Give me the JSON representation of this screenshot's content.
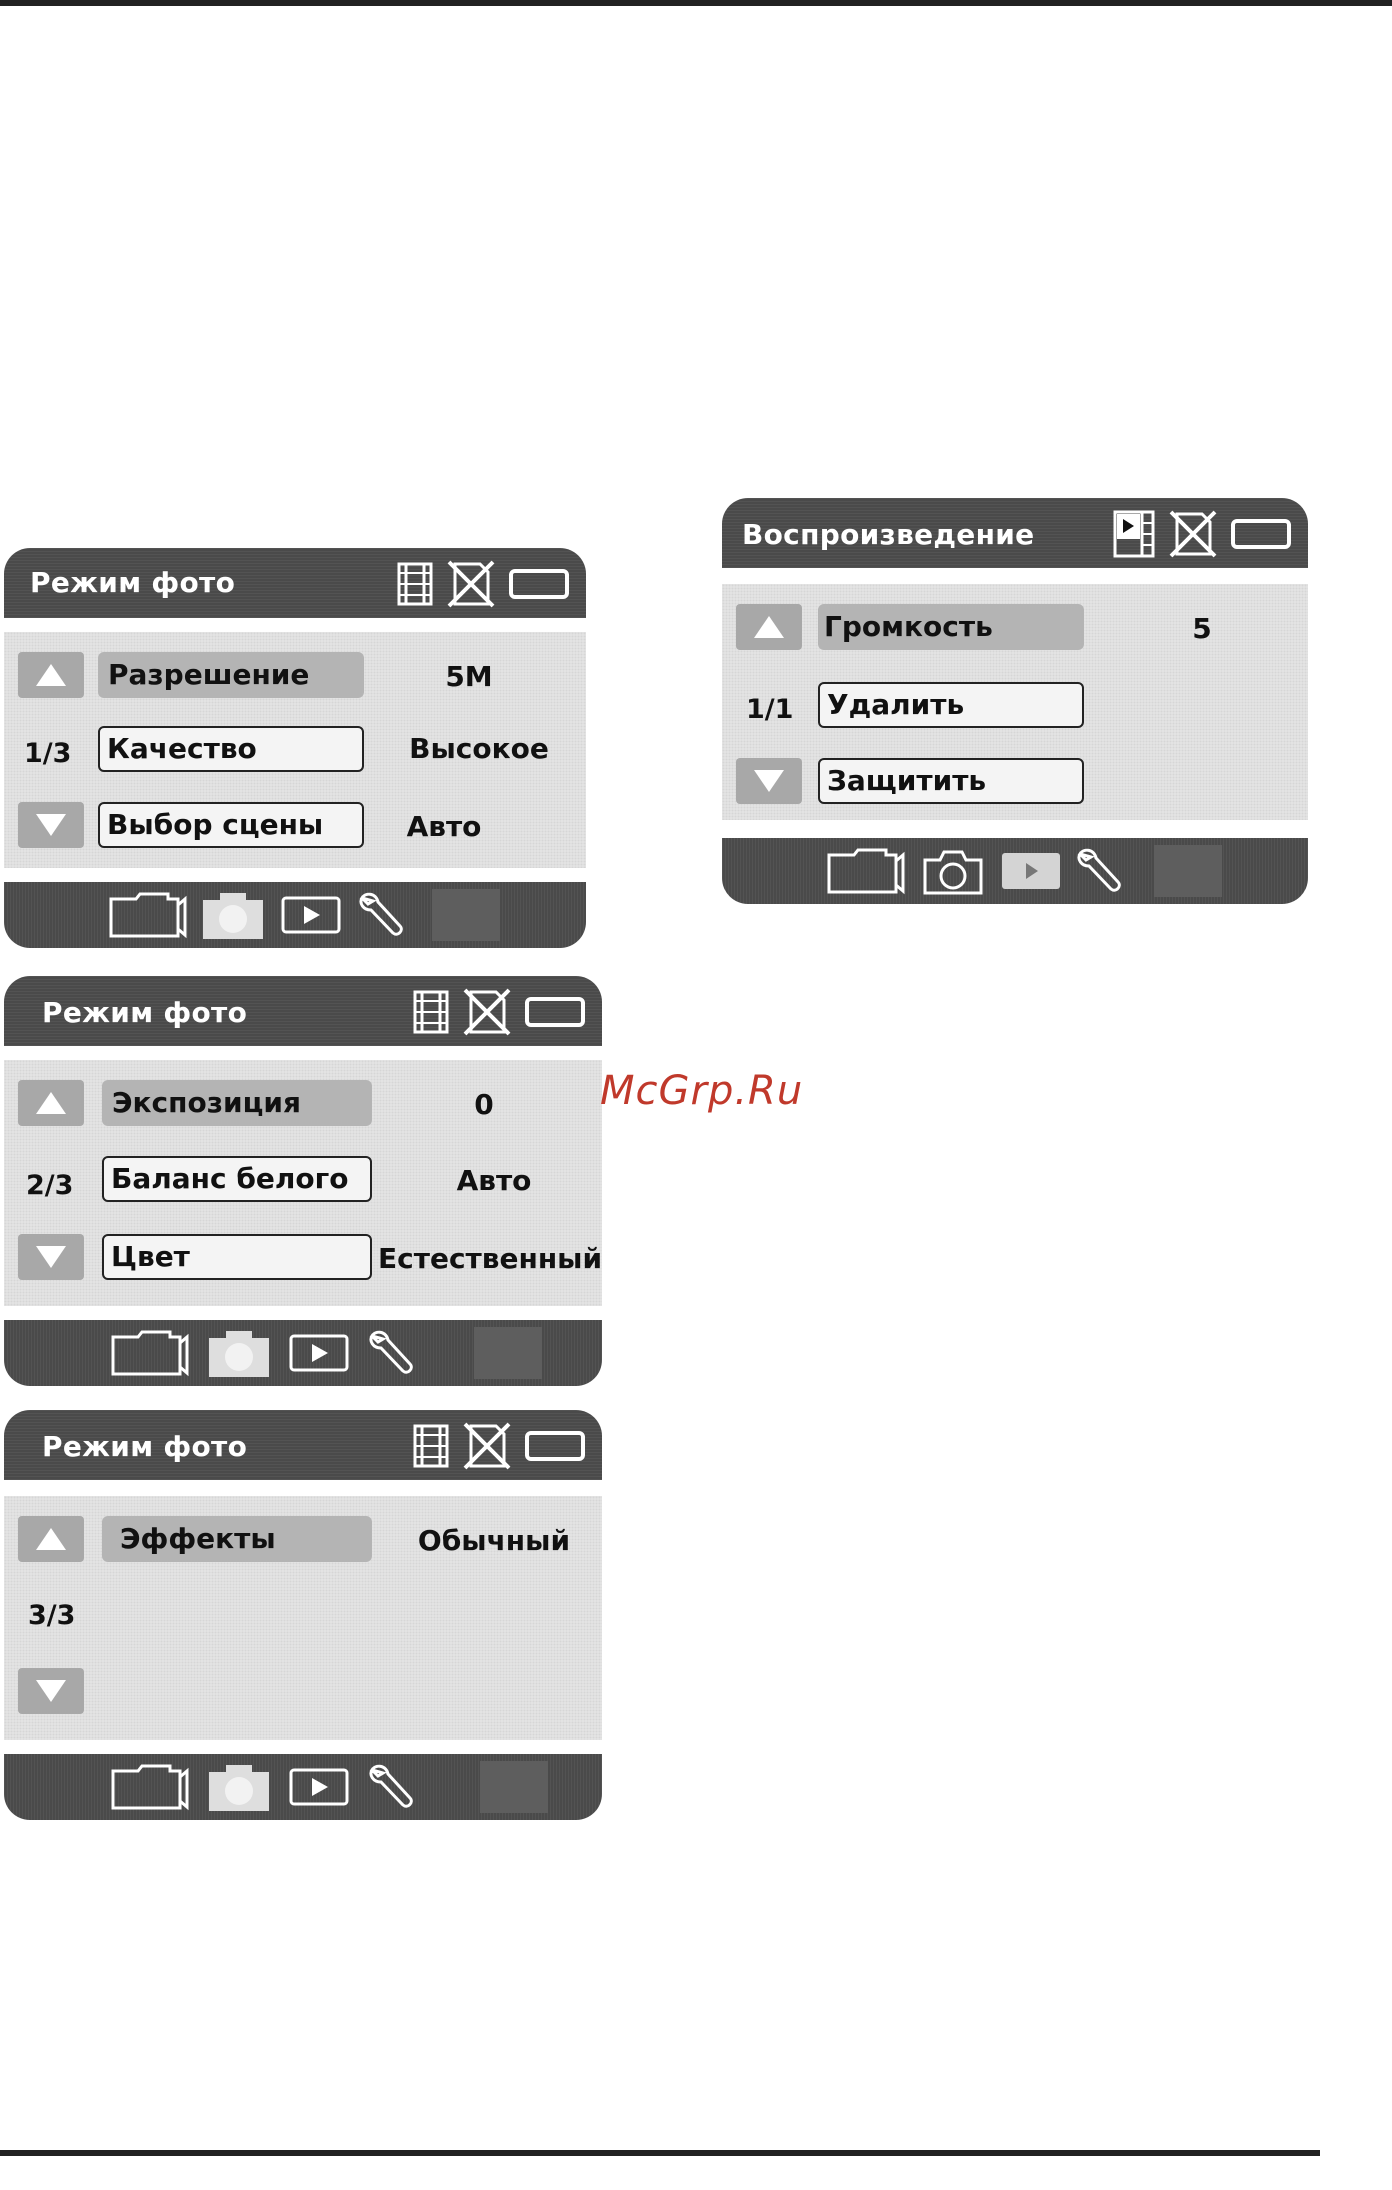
{
  "watermark": "McGrp.Ru",
  "screens": [
    {
      "title": "Режим фото",
      "page": "1/3",
      "items": [
        {
          "label": "Разрешение",
          "value": "5M",
          "selected": true
        },
        {
          "label": "Качество",
          "value": "Высокое",
          "selected": false
        },
        {
          "label": "Выбор сцены",
          "value": "Авто",
          "selected": false
        }
      ]
    },
    {
      "title": "Режим фото",
      "page": "2/3",
      "items": [
        {
          "label": "Экспозиция",
          "value": "0",
          "selected": true
        },
        {
          "label": "Баланс белого",
          "value": "Авто",
          "selected": false
        },
        {
          "label": "Цвет",
          "value": "Естественный",
          "selected": false
        }
      ]
    },
    {
      "title": "Режим фото",
      "page": "3/3",
      "items": [
        {
          "label": "Эффекты",
          "value": "Обычный",
          "selected": true
        }
      ]
    },
    {
      "title": "Воспроизведение",
      "page": "1/1",
      "items": [
        {
          "label": "Громкость",
          "value": "5",
          "selected": true
        },
        {
          "label": "Удалить",
          "value": "",
          "selected": false
        },
        {
          "label": "Защитить",
          "value": "",
          "selected": false
        }
      ]
    }
  ],
  "icons": {
    "header": [
      "film-strip-icon",
      "no-card-icon",
      "battery-icon"
    ],
    "footer": [
      "folder-icon",
      "camera-icon",
      "playback-icon",
      "wrench-icon"
    ]
  }
}
